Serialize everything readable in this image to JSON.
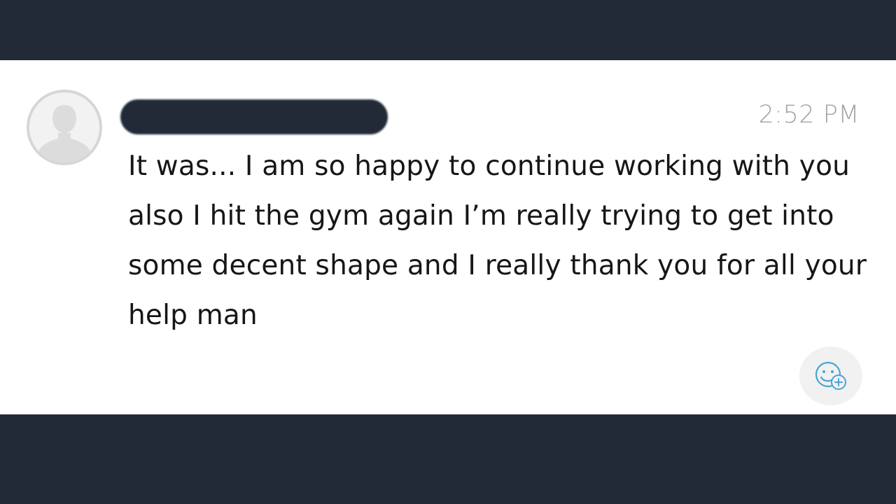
{
  "message": {
    "sender_name": "",
    "timestamp": "2:52 PM",
    "text": "It was... I am so happy to continue working with you also I hit the gym again I’m really trying to get into some decent shape and I really thank you for all your help man"
  },
  "icons": {
    "avatar": "person-silhouette-icon",
    "react": "add-reaction-icon"
  },
  "colors": {
    "bar_background": "#222a38",
    "card_background": "#ffffff",
    "timestamp": "#a3a3a3",
    "message_text": "#161616",
    "react_icon": "#4aa3d6"
  }
}
